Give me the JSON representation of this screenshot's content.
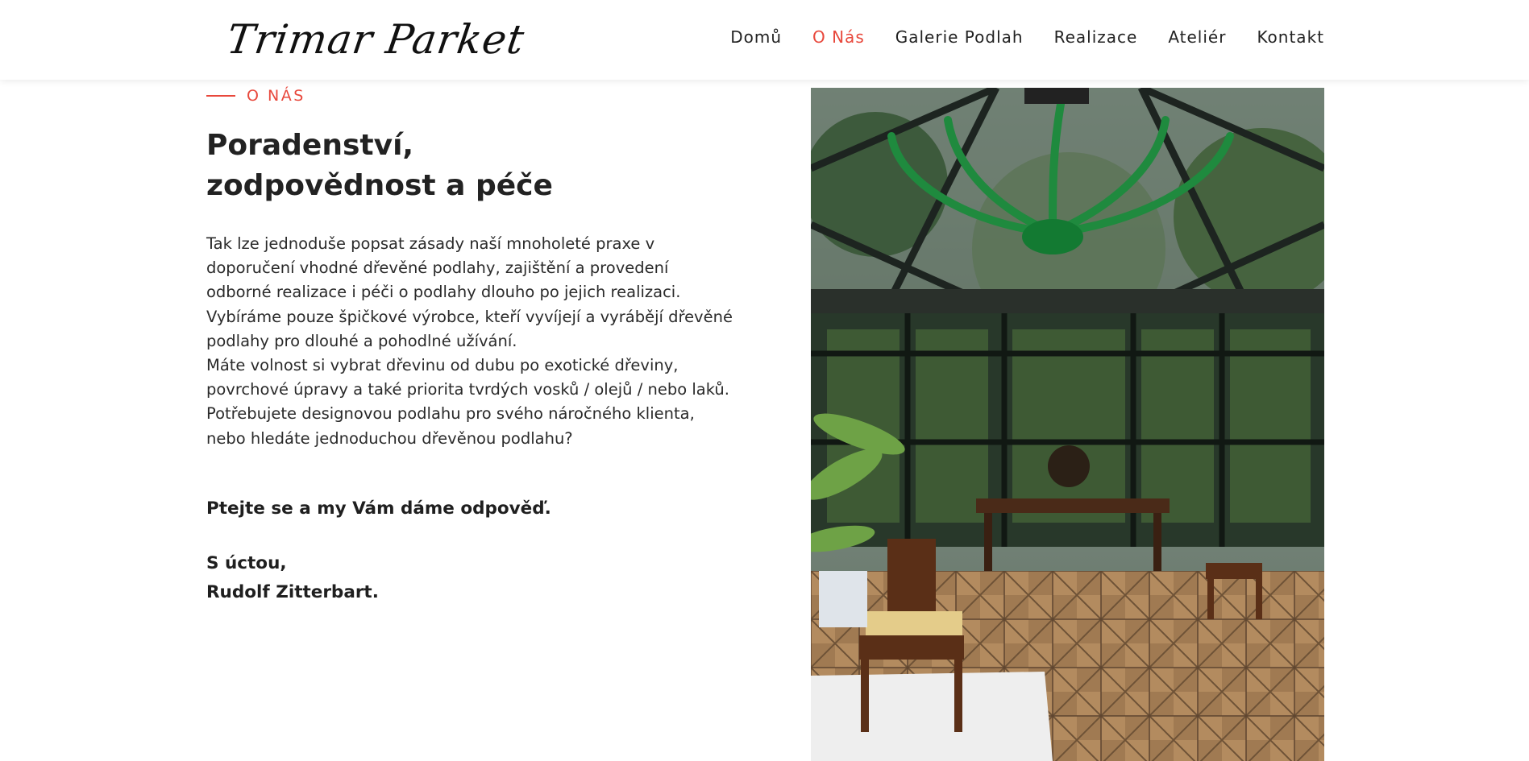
{
  "header": {
    "logo_text": "Trimar Parket",
    "nav": [
      {
        "label": "Domů",
        "active": false
      },
      {
        "label": "O Nás",
        "active": true
      },
      {
        "label": "Galerie Podlah",
        "active": false
      },
      {
        "label": "Realizace",
        "active": false
      },
      {
        "label": "Ateliér",
        "active": false
      },
      {
        "label": "Kontakt",
        "active": false
      }
    ]
  },
  "content": {
    "section_tag": "O NÁS",
    "title_lines": [
      "Poradenství,",
      "zodpovědnost a péče"
    ],
    "body_lines": [
      "Tak lze jednoduše popsat zásady naší mnoholeté praxe v",
      "doporučení vhodné dřevěné podlahy, zajištění a provedení",
      "odborné realizace i péči o podlahy dlouho po jejich realizaci.",
      "Vybíráme pouze špičkové výrobce, kteří vyvíjejí a vyrábějí dřevěné",
      "podlahy pro dlouhé a pohodlné užívání.",
      "Máte volnost si vybrat dřevinu od dubu po exotické dřeviny,",
      "povrchové úpravy a také priorita tvrdých vosků / olejů / nebo laků.",
      "Potřebujete designovou podlahu pro svého náročného klienta,",
      "nebo hledáte jednoduchou dřevěnou podlahu?"
    ],
    "cta": "Ptejte se a my Vám dáme odpověď.",
    "signature_lines": [
      "S úctou,",
      "Rudolf Zitterbart."
    ]
  },
  "colors": {
    "accent": "#e8483c",
    "text": "#222222",
    "background": "#ffffff"
  }
}
